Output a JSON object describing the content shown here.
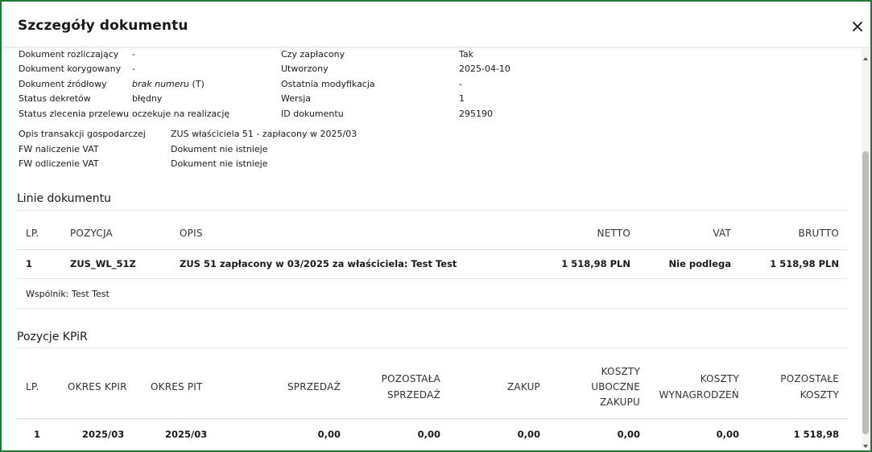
{
  "dialog": {
    "title": "Szczegóły dokumentu"
  },
  "details_left": [
    {
      "label": "Dokument rozliczający",
      "value": "-"
    },
    {
      "label": "Dokument korygowany",
      "value": "-"
    },
    {
      "label": "Dokument źródłowy",
      "value_italic": "brak numeru",
      "value_suffix": " (T)"
    },
    {
      "label": "Status dekretów",
      "value": "błędny"
    },
    {
      "label": "Status zlecenia przelewu",
      "value": "oczekuje na realizację"
    }
  ],
  "details_right": [
    {
      "label": "Czy zapłacony",
      "value": "Tak"
    },
    {
      "label": "Utworzony",
      "value": "2025-04-10"
    },
    {
      "label": "Ostatnia modyfikacja",
      "value": "-"
    },
    {
      "label": "Wersja",
      "value": "1"
    },
    {
      "label": "ID dokumentu",
      "value": "295190"
    }
  ],
  "details_extra": [
    {
      "label": "Opis transakcji gospodarczej",
      "value": "ZUS właściciela 51 - zapłacony w 2025/03"
    },
    {
      "label": "FW naliczenie VAT",
      "value": "Dokument nie istnieje"
    },
    {
      "label": "FW odliczenie VAT",
      "value": "Dokument nie istnieje"
    }
  ],
  "lines": {
    "title": "Linie dokumentu",
    "headers": [
      "LP.",
      "POZYCJA",
      "OPIS",
      "NETTO",
      "VAT",
      "BRUTTO"
    ],
    "rows": [
      [
        "1",
        "ZUS_WL_51Z",
        "ZUS 51 zapłacony w 03/2025 za właściciela: Test Test",
        "1 518,98 PLN",
        "Nie podlega",
        "1 518,98 PLN"
      ]
    ],
    "partner": "Wspólnik: Test Test"
  },
  "kpir": {
    "title": "Pozycje KPiR",
    "headers": [
      "LP.",
      "OKRES KPIR",
      "OKRES PIT",
      "SPRZEDAŻ",
      "POZOSTAŁA",
      "SPRZEDAŻ",
      "ZAKUP",
      "KOSZTY",
      "UBOCZNE",
      "ZAKUPU",
      "KOSZTY",
      "WYNAGRODZEŃ",
      "POZOSTAŁE",
      "KOSZTY"
    ],
    "rows": [
      [
        "1",
        "2025/03",
        "2025/03",
        "0,00",
        "0,00",
        "0,00",
        "0,00",
        "0,00",
        "1 518,98"
      ]
    ]
  },
  "icons": {
    "close": "close-icon",
    "scroll_up": "chevron-up-icon",
    "scroll_down": "chevron-down-icon"
  }
}
